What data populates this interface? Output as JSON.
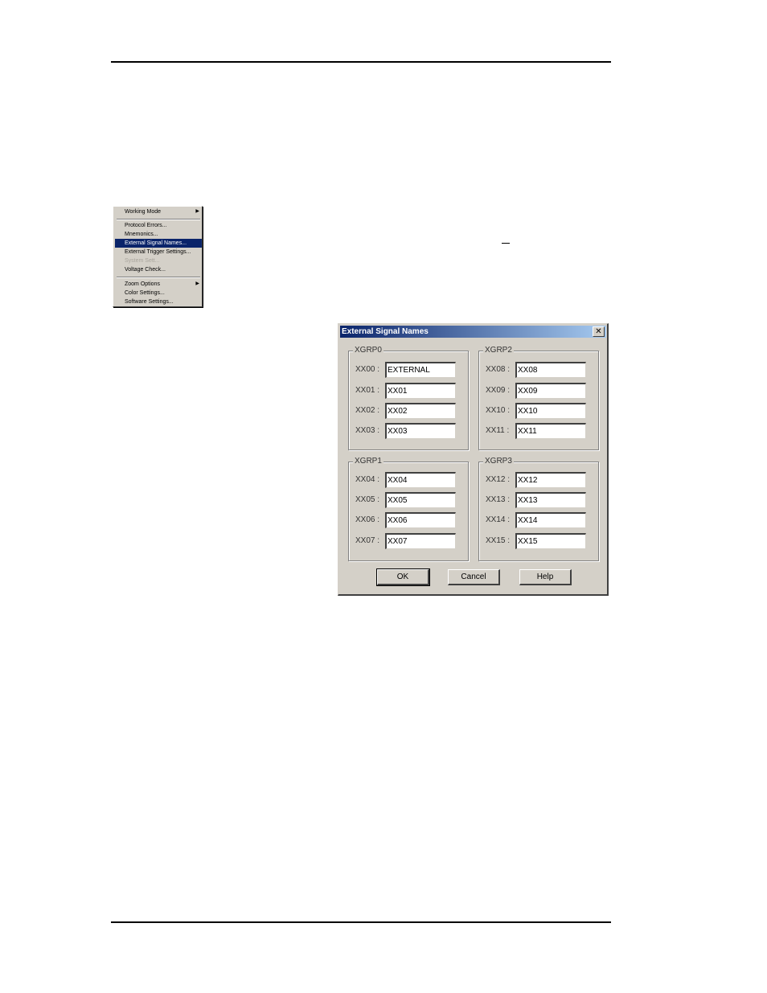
{
  "menu": {
    "items": [
      {
        "label": "Working Mode",
        "submenu": true,
        "disabled": false,
        "selected": false
      },
      {
        "label": "Protocol Errors...",
        "submenu": false,
        "disabled": false,
        "selected": false
      },
      {
        "label": "Mnemonics...",
        "submenu": false,
        "disabled": false,
        "selected": false
      },
      {
        "label": "External Signal Names...",
        "submenu": false,
        "disabled": false,
        "selected": true
      },
      {
        "label": "External Trigger Settings...",
        "submenu": false,
        "disabled": false,
        "selected": false
      },
      {
        "label": "System Sett...",
        "submenu": false,
        "disabled": true,
        "selected": false
      },
      {
        "label": "Voltage Check...",
        "submenu": false,
        "disabled": false,
        "selected": false
      },
      {
        "label": "Zoom Options",
        "submenu": true,
        "disabled": false,
        "selected": false
      },
      {
        "label": "Color Settings...",
        "submenu": false,
        "disabled": false,
        "selected": false
      },
      {
        "label": "Software Settings...",
        "submenu": false,
        "disabled": false,
        "selected": false
      }
    ],
    "arrow_glyph": "▶"
  },
  "dialog": {
    "title": "External Signal Names",
    "close_glyph": "✕",
    "groups": [
      {
        "label": "XGRP0",
        "fields": [
          {
            "label": "XX00 :",
            "value": "EXTERNAL"
          },
          {
            "label": "XX01 :",
            "value": "XX01"
          },
          {
            "label": "XX02 :",
            "value": "XX02"
          },
          {
            "label": "XX03 :",
            "value": "XX03"
          }
        ]
      },
      {
        "label": "XGRP2",
        "fields": [
          {
            "label": "XX08 :",
            "value": "XX08"
          },
          {
            "label": "XX09 :",
            "value": "XX09"
          },
          {
            "label": "XX10 :",
            "value": "XX10"
          },
          {
            "label": "XX11 :",
            "value": "XX11"
          }
        ]
      },
      {
        "label": "XGRP1",
        "fields": [
          {
            "label": "XX04 :",
            "value": "XX04"
          },
          {
            "label": "XX05 :",
            "value": "XX05"
          },
          {
            "label": "XX06 :",
            "value": "XX06"
          },
          {
            "label": "XX07 :",
            "value": "XX07"
          }
        ]
      },
      {
        "label": "XGRP3",
        "fields": [
          {
            "label": "XX12 :",
            "value": "XX12"
          },
          {
            "label": "XX13 :",
            "value": "XX13"
          },
          {
            "label": "XX14 :",
            "value": "XX14"
          },
          {
            "label": "XX15 :",
            "value": "XX15"
          }
        ]
      }
    ],
    "buttons": {
      "ok": "OK",
      "cancel": "Cancel",
      "help": "Help"
    }
  }
}
